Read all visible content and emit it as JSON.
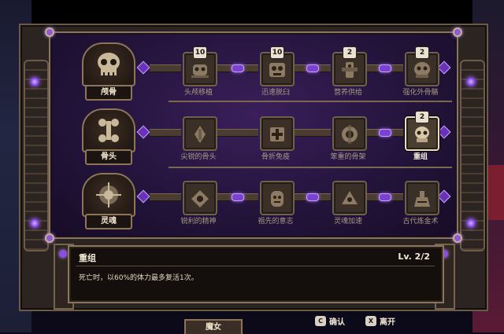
{
  "categories": [
    {
      "label": "颅骨",
      "icon": "skull-icon"
    },
    {
      "label": "骨头",
      "icon": "bone-icon"
    },
    {
      "label": "灵魂",
      "icon": "soul-icon"
    }
  ],
  "rows": [
    {
      "nodes": [
        {
          "name": "头颅移植",
          "badge": "10",
          "icon": "skull-transplant-icon",
          "active": false
        },
        {
          "name": "迅速脱臼",
          "badge": "10",
          "icon": "dislocation-icon",
          "active": false
        },
        {
          "name": "营养供给",
          "badge": "2",
          "icon": "nutrition-icon",
          "active": false
        },
        {
          "name": "强化外骨骼",
          "badge": "2",
          "icon": "exoskeleton-icon",
          "active": false
        }
      ]
    },
    {
      "nodes": [
        {
          "name": "尖锐的骨头",
          "badge": "",
          "icon": "sharp-bone-icon",
          "active": false
        },
        {
          "name": "骨折免疫",
          "badge": "",
          "icon": "fracture-immunity-icon",
          "active": false
        },
        {
          "name": "笨重的骨架",
          "badge": "",
          "icon": "heavy-skeleton-icon",
          "active": false
        },
        {
          "name": "重组",
          "badge": "2",
          "icon": "reassemble-icon",
          "active": true
        }
      ]
    },
    {
      "nodes": [
        {
          "name": "锐利的精神",
          "badge": "",
          "icon": "sharp-spirit-icon",
          "active": false
        },
        {
          "name": "祖先的意志",
          "badge": "",
          "icon": "ancestor-will-icon",
          "active": false
        },
        {
          "name": "灵魂加速",
          "badge": "",
          "icon": "soul-haste-icon",
          "active": false
        },
        {
          "name": "古代炼金术",
          "badge": "",
          "icon": "alchemy-icon",
          "active": false
        }
      ]
    }
  ],
  "detail": {
    "title": "重组",
    "level": "Lv. 2/2",
    "description": "死亡时，以60%的体力最多复活1次。"
  },
  "footer": {
    "character_tab": "魔女",
    "confirm_key": "C",
    "confirm_label": "确认",
    "exit_key": "X",
    "exit_label": "离开"
  },
  "colors": {
    "accent_gem": "#7b42d2",
    "frame": "#8a7560",
    "panel_bg": "#24143c"
  }
}
